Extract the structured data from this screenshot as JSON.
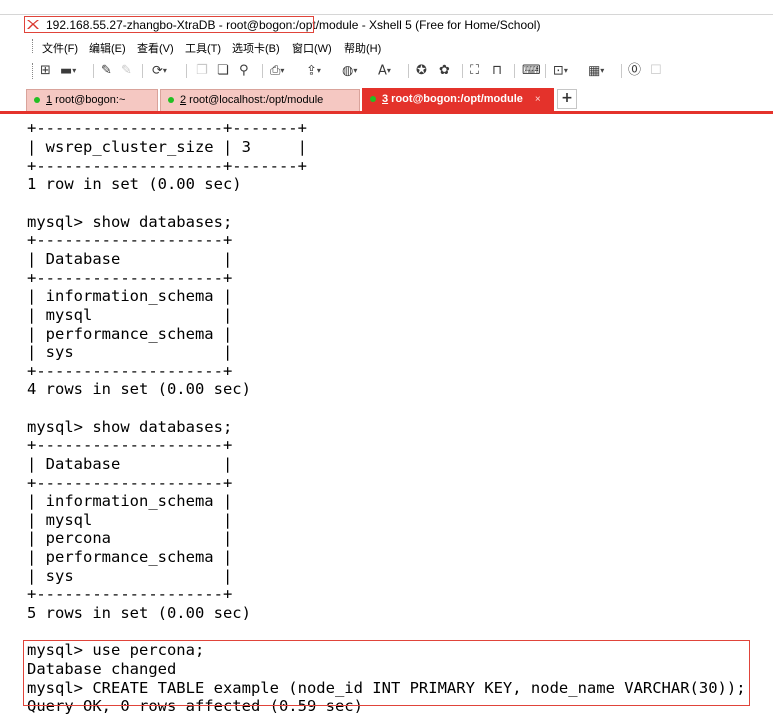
{
  "window": {
    "title": "192.168.55.27-zhangbo-XtraDB - root@bogon:/opt/module - Xshell 5 (Free for Home/School)",
    "logo_icon": "xshell-logo-icon"
  },
  "menubar": {
    "items": [
      "文件(F)",
      "编辑(E)",
      "查看(V)",
      "工具(T)",
      "选项卡(B)",
      "窗口(W)",
      "帮助(H)"
    ]
  },
  "toolbar": {
    "icons": [
      "new-session-icon",
      "open-folder-icon",
      "connect-icon",
      "disconnect-icon",
      "reconnect-icon",
      "copy-icon",
      "paste-icon",
      "find-icon",
      "print-icon",
      "transfer-icon",
      "globe-icon",
      "font-icon",
      "xftp-icon",
      "xmanager-icon",
      "fullscreen-icon",
      "lock-icon",
      "keyboard-icon",
      "compose-icon",
      "layout-icon",
      "help-icon",
      "chat-icon"
    ]
  },
  "tabs": [
    {
      "number": "1",
      "label": " root@bogon:~",
      "active": false
    },
    {
      "number": "2",
      "label": " root@localhost:/opt/module",
      "active": false
    },
    {
      "number": "3",
      "label": " root@bogon:/opt/module",
      "active": true
    }
  ],
  "tab_close": "×",
  "tab_add": "+",
  "colors": {
    "accent": "#e4322b",
    "inactive_tab": "#f5c8c2",
    "status_dot": "#22bf22",
    "highlight_box": "#e0443a"
  },
  "terminal": {
    "lines": [
      "+--------------------+-------+",
      "| wsrep_cluster_size | 3     |",
      "+--------------------+-------+",
      "1 row in set (0.00 sec)",
      "",
      "mysql> show databases;",
      "+--------------------+",
      "| Database           |",
      "+--------------------+",
      "| information_schema |",
      "| mysql              |",
      "| performance_schema |",
      "| sys                |",
      "+--------------------+",
      "4 rows in set (0.00 sec)",
      "",
      "mysql> show databases;",
      "+--------------------+",
      "| Database           |",
      "+--------------------+",
      "| information_schema |",
      "| mysql              |",
      "| percona            |",
      "| performance_schema |",
      "| sys                |",
      "+--------------------+",
      "5 rows in set (0.00 sec)",
      "",
      "mysql> use percona;",
      "Database changed",
      "mysql> CREATE TABLE example (node_id INT PRIMARY KEY, node_name VARCHAR(30));",
      "Query OK, 0 rows affected (0.59 sec)"
    ]
  }
}
